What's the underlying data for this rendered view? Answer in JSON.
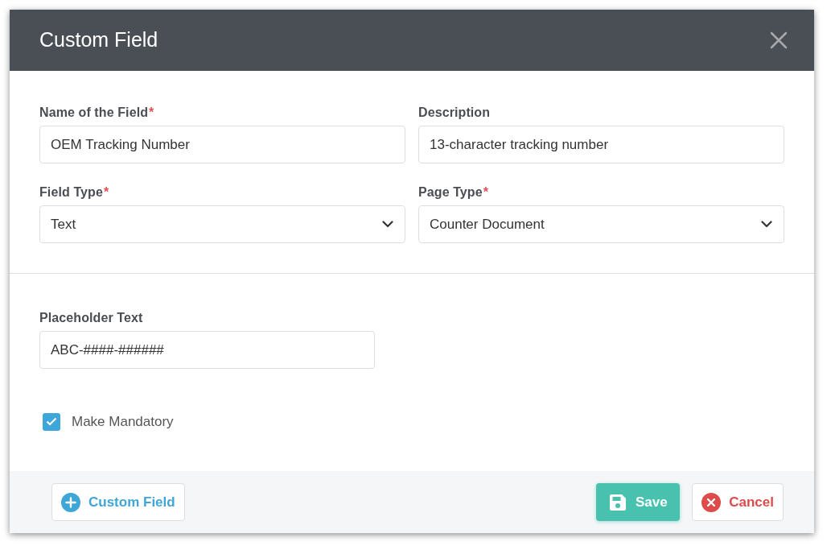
{
  "dialog": {
    "title": "Custom Field"
  },
  "fields": [
    {
      "kind": "text",
      "label": "Name of the Field",
      "required_mark": "*",
      "value": "OEM Tracking Number"
    },
    {
      "kind": "text",
      "label": "Description",
      "value": "13-character tracking number"
    },
    {
      "kind": "select",
      "label": "Field Type",
      "required_mark": "*",
      "value": "Text"
    },
    {
      "kind": "select",
      "label": "Page Type",
      "required_mark": "*",
      "value": "Counter Document"
    }
  ],
  "placeholder_field": {
    "label": "Placeholder Text",
    "value": "ABC-####-######"
  },
  "mandatory": {
    "label": "Make Mandatory",
    "checked": true
  },
  "footer": {
    "add_button": "Custom Field",
    "save_button": "Save",
    "cancel_button": "Cancel"
  }
}
